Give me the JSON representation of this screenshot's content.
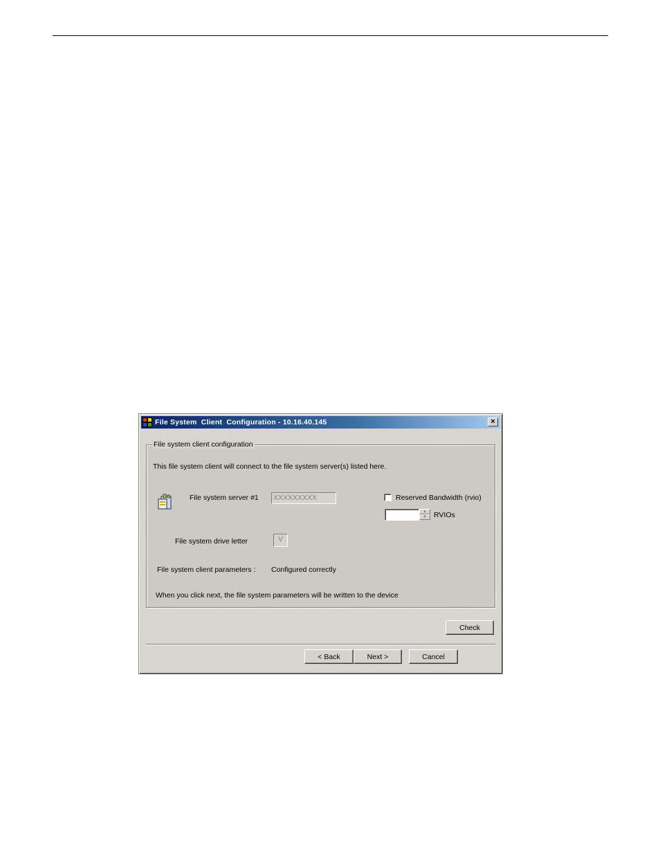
{
  "window": {
    "title": "File System  Client  Configuration - 10.16.40.145",
    "close_label": "×"
  },
  "group": {
    "legend": "File system client configuration",
    "intro": "This file system client will connect to the file system server(s) listed here.",
    "server_label": "File system server #1",
    "server_value": "XXXXXXXXX",
    "reserved_label": "Reserved Bandwidth (rvio)",
    "reserved_checked": false,
    "rvio_value": "",
    "rvio_label": "RVIOs",
    "drive_label": "File system drive letter",
    "drive_value": "V",
    "params_label": "File system client parameters :",
    "params_value": "Configured correctly",
    "footer_note": "When you click next, the file system parameters will be written to the device"
  },
  "buttons": {
    "check": "Check",
    "back": "< Back",
    "next": "Next >",
    "cancel": "Cancel"
  },
  "icons": {
    "app": "app-icon",
    "server": "server-icon",
    "spin_up": "spin-up-icon",
    "spin_down": "spin-down-icon",
    "close": "close-icon"
  }
}
